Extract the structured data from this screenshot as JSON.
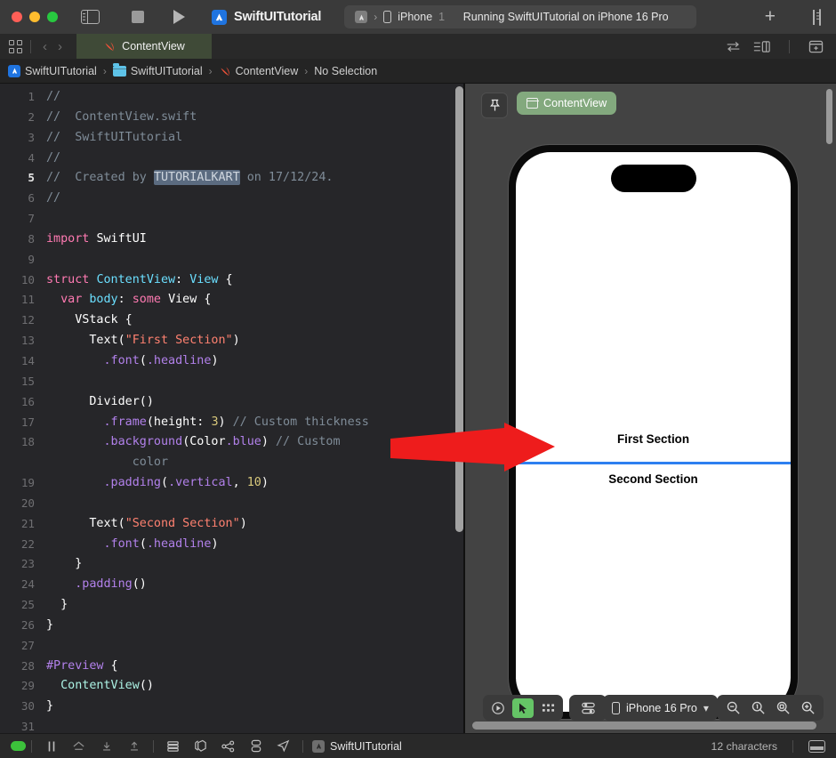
{
  "window": {
    "app_icon": "xcode-icon",
    "project_name": "SwiftUITutorial",
    "sidebar_toggle_icon": "sidebar-toggle-icon",
    "stop_icon": "stop-icon",
    "run_icon": "run-icon",
    "add_icon": "plus-icon",
    "inspector_toggle_icon": "inspector-toggle-icon"
  },
  "scheme": {
    "scheme_icon": "app-scheme-icon",
    "separator": "›",
    "device_icon": "iphone-icon",
    "device_name": "iPhone",
    "device_number": "1",
    "status_message": "Running SwiftUITutorial on iPhone 16 Pro"
  },
  "tabbar": {
    "grid_icon": "tab-grid-icon",
    "back_arrow": "‹",
    "forward_arrow": "›",
    "active_tab": {
      "icon": "swift-file-icon",
      "label": "ContentView"
    },
    "right_icons": [
      "swap-editors-icon",
      "split-editor-icon",
      "add-editor-icon"
    ]
  },
  "breadcrumb": {
    "separator": "›",
    "items": [
      {
        "icon": "xcode-project-icon",
        "label": "SwiftUITutorial"
      },
      {
        "icon": "folder-icon",
        "label": "SwiftUITutorial"
      },
      {
        "icon": "swift-file-icon",
        "label": "ContentView"
      },
      {
        "icon": "",
        "label": "No Selection"
      }
    ]
  },
  "editor": {
    "current_line": 5,
    "selected_token": "TUTORIALKART",
    "lines": [
      {
        "n": "1",
        "segments": [
          {
            "t": "//",
            "c": "cmt"
          }
        ]
      },
      {
        "n": "2",
        "segments": [
          {
            "t": "//  ContentView.swift",
            "c": "cmt"
          }
        ]
      },
      {
        "n": "3",
        "segments": [
          {
            "t": "//  SwiftUITutorial",
            "c": "cmt"
          }
        ]
      },
      {
        "n": "4",
        "segments": [
          {
            "t": "//",
            "c": "cmt"
          }
        ]
      },
      {
        "n": "5",
        "segments": [
          {
            "t": "//  Created by ",
            "c": "cmt"
          },
          {
            "t": "TUTORIALKART",
            "c": "sel"
          },
          {
            "t": " on 17/12/24.",
            "c": "cmt"
          }
        ]
      },
      {
        "n": "6",
        "segments": [
          {
            "t": "//",
            "c": "cmt"
          }
        ]
      },
      {
        "n": "7",
        "segments": [
          {
            "t": "",
            "c": "plain"
          }
        ]
      },
      {
        "n": "8",
        "segments": [
          {
            "t": "import",
            "c": "kw"
          },
          {
            "t": " ",
            "c": "plain"
          },
          {
            "t": "SwiftUI",
            "c": "plain"
          }
        ]
      },
      {
        "n": "9",
        "segments": [
          {
            "t": "",
            "c": "plain"
          }
        ]
      },
      {
        "n": "10",
        "segments": [
          {
            "t": "struct",
            "c": "kw"
          },
          {
            "t": " ",
            "c": "plain"
          },
          {
            "t": "ContentView",
            "c": "type"
          },
          {
            "t": ": ",
            "c": "plain"
          },
          {
            "t": "View",
            "c": "type"
          },
          {
            "t": " {",
            "c": "plain"
          }
        ]
      },
      {
        "n": "11",
        "segments": [
          {
            "t": "  ",
            "c": "plain"
          },
          {
            "t": "var",
            "c": "kw"
          },
          {
            "t": " ",
            "c": "plain"
          },
          {
            "t": "body",
            "c": "type"
          },
          {
            "t": ": ",
            "c": "plain"
          },
          {
            "t": "some",
            "c": "kw"
          },
          {
            "t": " ",
            "c": "plain"
          },
          {
            "t": "View",
            "c": "plain"
          },
          {
            "t": " {",
            "c": "plain"
          }
        ]
      },
      {
        "n": "12",
        "segments": [
          {
            "t": "    VStack {",
            "c": "plain"
          }
        ]
      },
      {
        "n": "13",
        "segments": [
          {
            "t": "      Text(",
            "c": "plain"
          },
          {
            "t": "\"First Section\"",
            "c": "str"
          },
          {
            "t": ")",
            "c": "plain"
          }
        ]
      },
      {
        "n": "14",
        "segments": [
          {
            "t": "        ",
            "c": "plain"
          },
          {
            "t": ".font",
            "c": "fn"
          },
          {
            "t": "(",
            "c": "plain"
          },
          {
            "t": ".headline",
            "c": "fn"
          },
          {
            "t": ")",
            "c": "plain"
          }
        ]
      },
      {
        "n": "15",
        "segments": [
          {
            "t": "",
            "c": "plain"
          }
        ]
      },
      {
        "n": "16",
        "segments": [
          {
            "t": "      Divider()",
            "c": "plain"
          }
        ]
      },
      {
        "n": "17",
        "segments": [
          {
            "t": "        ",
            "c": "plain"
          },
          {
            "t": ".frame",
            "c": "fn"
          },
          {
            "t": "(height: ",
            "c": "plain"
          },
          {
            "t": "3",
            "c": "num"
          },
          {
            "t": ") ",
            "c": "plain"
          },
          {
            "t": "// Custom thickness",
            "c": "cmt"
          }
        ]
      },
      {
        "n": "18",
        "segments": [
          {
            "t": "        ",
            "c": "plain"
          },
          {
            "t": ".background",
            "c": "fn"
          },
          {
            "t": "(",
            "c": "plain"
          },
          {
            "t": "Color",
            "c": "plain"
          },
          {
            "t": ".blue",
            "c": "fn"
          },
          {
            "t": ") ",
            "c": "plain"
          },
          {
            "t": "// Custom",
            "c": "cmt"
          }
        ]
      },
      {
        "n": "",
        "segments": [
          {
            "t": "            color",
            "c": "cmt"
          }
        ]
      },
      {
        "n": "19",
        "segments": [
          {
            "t": "        ",
            "c": "plain"
          },
          {
            "t": ".padding",
            "c": "fn"
          },
          {
            "t": "(",
            "c": "plain"
          },
          {
            "t": ".vertical",
            "c": "fn"
          },
          {
            "t": ", ",
            "c": "plain"
          },
          {
            "t": "10",
            "c": "num"
          },
          {
            "t": ")",
            "c": "plain"
          }
        ]
      },
      {
        "n": "20",
        "segments": [
          {
            "t": "",
            "c": "plain"
          }
        ]
      },
      {
        "n": "21",
        "segments": [
          {
            "t": "      Text(",
            "c": "plain"
          },
          {
            "t": "\"Second Section\"",
            "c": "str"
          },
          {
            "t": ")",
            "c": "plain"
          }
        ]
      },
      {
        "n": "22",
        "segments": [
          {
            "t": "        ",
            "c": "plain"
          },
          {
            "t": ".font",
            "c": "fn"
          },
          {
            "t": "(",
            "c": "plain"
          },
          {
            "t": ".headline",
            "c": "fn"
          },
          {
            "t": ")",
            "c": "plain"
          }
        ]
      },
      {
        "n": "23",
        "segments": [
          {
            "t": "    }",
            "c": "plain"
          }
        ]
      },
      {
        "n": "24",
        "segments": [
          {
            "t": "    ",
            "c": "plain"
          },
          {
            "t": ".padding",
            "c": "fn"
          },
          {
            "t": "()",
            "c": "plain"
          }
        ]
      },
      {
        "n": "25",
        "segments": [
          {
            "t": "  }",
            "c": "plain"
          }
        ]
      },
      {
        "n": "26",
        "segments": [
          {
            "t": "}",
            "c": "plain"
          }
        ]
      },
      {
        "n": "27",
        "segments": [
          {
            "t": "",
            "c": "plain"
          }
        ]
      },
      {
        "n": "28",
        "segments": [
          {
            "t": "#Preview",
            "c": "macro"
          },
          {
            "t": " {",
            "c": "plain"
          }
        ]
      },
      {
        "n": "29",
        "segments": [
          {
            "t": "  ",
            "c": "plain"
          },
          {
            "t": "ContentView",
            "c": "proj"
          },
          {
            "t": "()",
            "c": "plain"
          }
        ]
      },
      {
        "n": "30",
        "segments": [
          {
            "t": "}",
            "c": "plain"
          }
        ]
      },
      {
        "n": "31",
        "segments": [
          {
            "t": "",
            "c": "plain"
          }
        ]
      }
    ]
  },
  "canvas": {
    "pin_icon": "pin-icon",
    "preview_pill": {
      "icon": "preview-window-icon",
      "label": "ContentView"
    },
    "preview_content": {
      "first_section": "First Section",
      "second_section": "Second Section",
      "divider_color": "#2d7ff0"
    },
    "bottom_bar": {
      "play_icon": "play-preview-icon",
      "select_icon": "selection-cursor-icon",
      "variants_icon": "variants-grid-icon",
      "device_settings_icon": "device-settings-icon",
      "device_picker": {
        "icon": "iphone-icon",
        "label": "iPhone 16 Pro",
        "chevron": "⌄"
      },
      "zoom_out_icon": "zoom-out-icon",
      "zoom_100_icon": "zoom-100-icon",
      "zoom_fit_icon": "zoom-fit-icon",
      "zoom_in_icon": "zoom-in-icon"
    }
  },
  "annotation": {
    "arrow_icon": "red-arrow-annotation",
    "color": "#ee1c1c"
  },
  "statusbar": {
    "indicator_icon": "build-status-indicator",
    "icons": [
      "pause-icon",
      "home-icon",
      "download-icon",
      "upload-icon",
      "layers-icon",
      "package-icon",
      "share-icon",
      "database-icon",
      "location-icon"
    ],
    "project_icon": "xcode-project-icon",
    "project_label": "SwiftUITutorial",
    "character_count": "12 characters",
    "panel_toggle_icon": "bottom-panel-toggle-icon"
  }
}
